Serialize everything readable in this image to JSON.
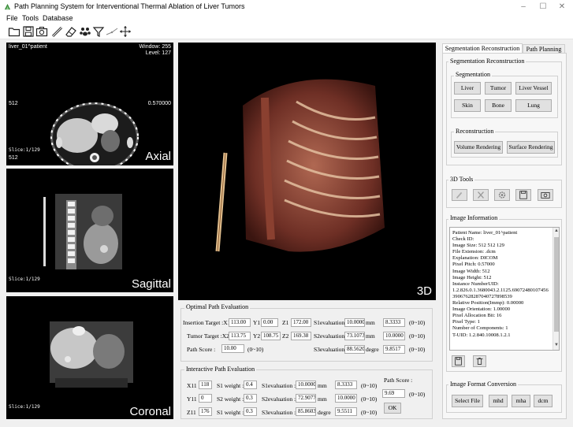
{
  "window": {
    "title": "Path Planning System for Interventional Thermal Ablation of Liver Tumors",
    "controls": [
      "–",
      "☐",
      "✕"
    ]
  },
  "menu": [
    "File",
    "Tools",
    "Database"
  ],
  "toolbar": {
    "icons": [
      "folder-open-icon",
      "save-icon",
      "camera-icon",
      "ruler-icon",
      "eraser-icon",
      "paw-icon",
      "funnel-icon",
      "angle-icon",
      "move-icon"
    ]
  },
  "views": {
    "axial": {
      "patient": "liver_01^patient",
      "window": "Window: 255",
      "level": "Level: 127",
      "left_value": "512",
      "right_value": "0.570000",
      "slice": "Slice:1/129",
      "bottom_value": "512",
      "label": "Axial"
    },
    "sagittal": {
      "slice": "Slice:1/129",
      "label": "Sagittal"
    },
    "coronal": {
      "slice": "Slice:1/129",
      "label": "Coronal"
    },
    "volume": {
      "label": "3D"
    }
  },
  "optimal": {
    "title": "Optimal Path Evaluation",
    "insertion_label": "Insertion Target :X1",
    "x1": "113.00",
    "y1_label": "Y1",
    "y1": "0.00",
    "z1_label": "Z1",
    "z1": "172.00",
    "tumor_label": "Tumor Target :X2",
    "x2": "113.75",
    "y2_label": "Y2",
    "y2": "108.75",
    "z2_label": "Z2",
    "z2": "169.38",
    "score_label": "Path Score :",
    "score": "10.00",
    "score_range": "(0~10)",
    "s1_label": "S1evaluation",
    "s1": "10.0000",
    "s1_unit": "mm",
    "s1_score": "8.3333",
    "s1_range": "(0~10)",
    "s2_label": "S2evaluation",
    "s2": "73.1073",
    "s2_unit": "mm",
    "s2_score": "10.0000",
    "s2_range": "(0~10)",
    "s3_label": "S3evaluation",
    "s3": "88.5620",
    "s3_unit": "degre",
    "s3_score": "9.8517",
    "s3_range": "(0~10)"
  },
  "interactive": {
    "title": "Interactive Path Evaluation",
    "x11_label": "X11",
    "x11": "118",
    "y11_label": "Y11",
    "y11": "0",
    "z11_label": "Z11",
    "z11": "176",
    "w1_label": "S1 weight :",
    "w1": "0.4",
    "w2_label": "S2 weight :",
    "w2": "0.3",
    "w3_label": "S1 weight :",
    "w3": "0.3",
    "e1_label": "S1evaluation :",
    "e1": "10.0000",
    "e1_unit": "mm",
    "e1_score": "8.3333",
    "e1_range": "(0~10)",
    "e2_label": "S2evaluation :",
    "e2": "72.9077",
    "e2_unit": "mm",
    "e2_score": "10.0000",
    "e2_range": "(0~10)",
    "e3_label": "S3evaluation :",
    "e3": "85.8603",
    "e3_unit": "degre",
    "e3_score": "9.5511",
    "e3_range": "(0~10)",
    "score_label": "Path Score :",
    "score": "9.69",
    "score_range": "(0~10)",
    "ok": "OK"
  },
  "tabs": [
    "Segmentation Reconstruction",
    "Path Planning"
  ],
  "seg": {
    "group_title": "Segmentation Reconstruction",
    "segmentation_title": "Segmentation",
    "buttons": [
      "Liver",
      "Tumor",
      "Liver Vessel",
      "Skin",
      "Bone",
      "Lung"
    ],
    "reconstruction_title": "Reconstruction",
    "volume_rendering": "Volume Rendering",
    "surface_rendering": "Surface Rendering"
  },
  "tools3d": {
    "title": "3D Tools"
  },
  "image_info": {
    "title": "Image Information",
    "lines": [
      "Patient Name: liver_01^patient",
      "Check ID:",
      "Image Size: 512 512 129",
      "File Extension: .dcm",
      "Explanation: DICOM",
      "Pixel Pitch: 0.57000",
      "Image Width: 512",
      "Image Height: 512",
      "Instance NumberUID:",
      "1.2.826.0.1.3680043.2.1125.69072480107456",
      "39067628287040727898539",
      "Relative Position(Immp): 0.00000",
      "Image Orientation: 1.00000",
      "Pixel Allocation Bit: 16",
      "Pixel Type: 1",
      "Number of Components: 1",
      "T-UID: 1.2.840.10008.1.2.1"
    ]
  },
  "format": {
    "title": "Image Format Conversion",
    "buttons": [
      "Select File",
      "mhd",
      "mha",
      "dcm"
    ]
  }
}
